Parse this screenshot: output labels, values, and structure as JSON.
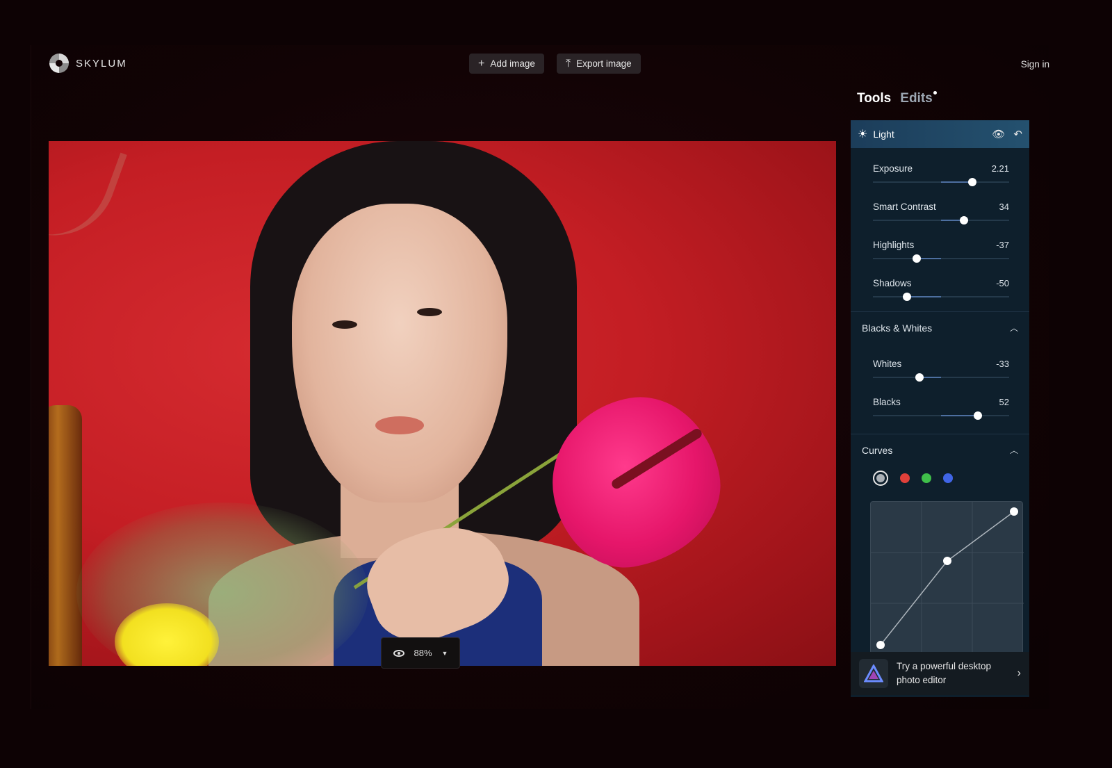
{
  "header": {
    "logo_text": "SKYLUM",
    "add_image": "Add image",
    "export_image": "Export image",
    "sign_in": "Sign in"
  },
  "viewer": {
    "zoom": "88%"
  },
  "panel": {
    "tabs": {
      "tools": "Tools",
      "edits": "Edits"
    },
    "light_title": "Light",
    "sliders": [
      {
        "label": "Exposure",
        "value": "2.21",
        "pos": 0.73
      },
      {
        "label": "Smart Contrast",
        "value": "34",
        "pos": 0.67
      },
      {
        "label": "Highlights",
        "value": "-37",
        "pos": 0.32
      },
      {
        "label": "Shadows",
        "value": "-50",
        "pos": 0.25
      }
    ],
    "blacks_whites_title": "Blacks & Whites",
    "bw_sliders": [
      {
        "label": "Whites",
        "value": "-33",
        "pos": 0.34
      },
      {
        "label": "Blacks",
        "value": "52",
        "pos": 0.77
      }
    ],
    "curves_title": "Curves",
    "channel_colors": {
      "all": "#aab0b6",
      "red": "#e0403a",
      "green": "#3fbf4a",
      "blue": "#4065e6"
    },
    "curve_points": [
      [
        0,
        0
      ],
      [
        0.5,
        0.63
      ],
      [
        1,
        1
      ]
    ]
  },
  "promo": {
    "text": "Try a powerful desktop photo editor"
  }
}
